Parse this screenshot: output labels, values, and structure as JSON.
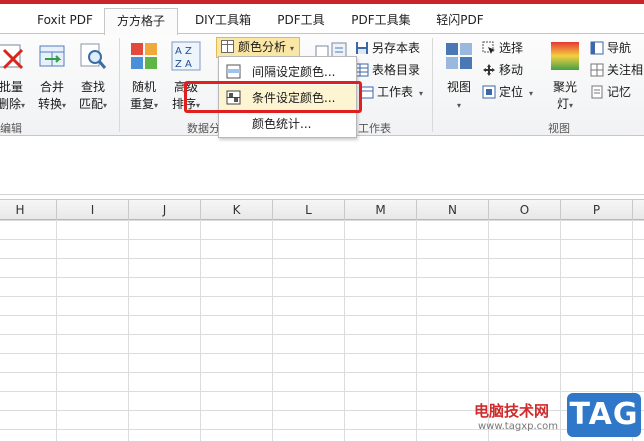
{
  "tabs": [
    {
      "label": "Foxit PDF",
      "active": false
    },
    {
      "label": "方方格子",
      "active": true
    },
    {
      "label": "DIY工具箱",
      "active": false
    },
    {
      "label": "PDF工具",
      "active": false
    },
    {
      "label": "PDF工具集",
      "active": false
    },
    {
      "label": "轻闪PDF",
      "active": false
    }
  ],
  "ribbon": {
    "edit_group": {
      "label": "编辑",
      "batch_delete": {
        "line1": "批量",
        "line2": "删除"
      },
      "merge_convert": {
        "line1": "合并",
        "line2": "转换"
      },
      "find_match": {
        "line1": "查找",
        "line2": "匹配"
      }
    },
    "data_group": {
      "label": "数据分",
      "random_repeat": {
        "line1": "随机",
        "line2": "重复"
      },
      "advanced_sort": {
        "line1": "高级",
        "line2": "排序"
      }
    },
    "color_analysis": {
      "label": "颜色分析"
    },
    "worksheet_group": {
      "label": "工作表",
      "save_sheet": "另存本表",
      "sheet_index": "表格目录",
      "worksheet": "工作表"
    },
    "view_group": {
      "label": "视图",
      "view": "视图",
      "select": "选择",
      "move": "移动",
      "locate": "定位",
      "spotlight": {
        "line1": "聚光",
        "line2": "灯"
      },
      "navigation": "导航",
      "follow": "关注相",
      "memory": "记忆"
    }
  },
  "color_menu": {
    "items": [
      {
        "label": "间隔设定颜色..."
      },
      {
        "label": "条件设定颜色...",
        "highlighted": true
      },
      {
        "label": "颜色统计..."
      }
    ]
  },
  "columns": [
    "H",
    "I",
    "J",
    "K",
    "L",
    "M",
    "N",
    "O",
    "P"
  ],
  "watermark": {
    "site_name": "电脑技术网",
    "url": "www.tagxp.com",
    "tag": "TAG"
  },
  "colors": {
    "top_accent": "#c8262a",
    "highlight_border": "#e01f1f",
    "color_button_bg": "#fbe7a5",
    "tag_blue": "#2f77c8"
  }
}
